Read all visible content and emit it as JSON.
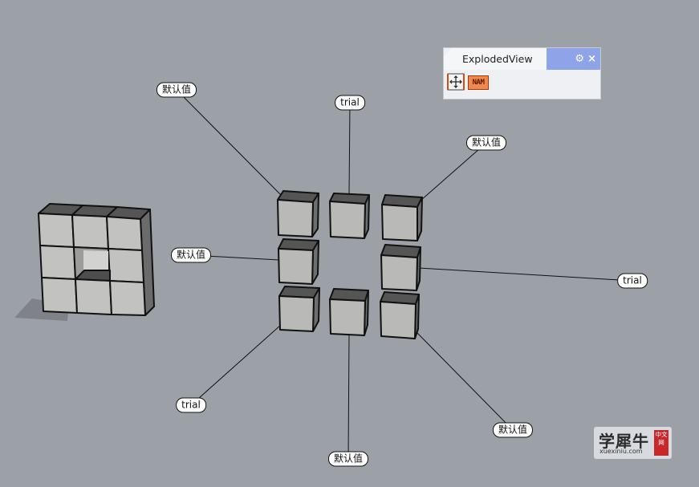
{
  "panel": {
    "title": "ExplodedView",
    "gear_icon": "gear-icon",
    "close_label": "×",
    "tools": [
      {
        "name": "explode-tool",
        "icon": "explode-arrows-icon"
      },
      {
        "name": "name-tool",
        "text": "NAM"
      }
    ],
    "accent_color": "#8ea3e8"
  },
  "viewport": {
    "background_color": "#9ca1a8",
    "labels": [
      {
        "id": "label-top-left",
        "text": "默认值"
      },
      {
        "id": "label-top",
        "text": "trial"
      },
      {
        "id": "label-top-right",
        "text": "默认值"
      },
      {
        "id": "label-left",
        "text": "默认值"
      },
      {
        "id": "label-right",
        "text": "trial"
      },
      {
        "id": "label-bottom-left",
        "text": "trial"
      },
      {
        "id": "label-bottom",
        "text": "默认值"
      },
      {
        "id": "label-bottom-right",
        "text": "默认值"
      }
    ]
  },
  "watermark": {
    "main": "学犀牛",
    "sub": "xuexiniu.com",
    "badge": "中文网"
  }
}
